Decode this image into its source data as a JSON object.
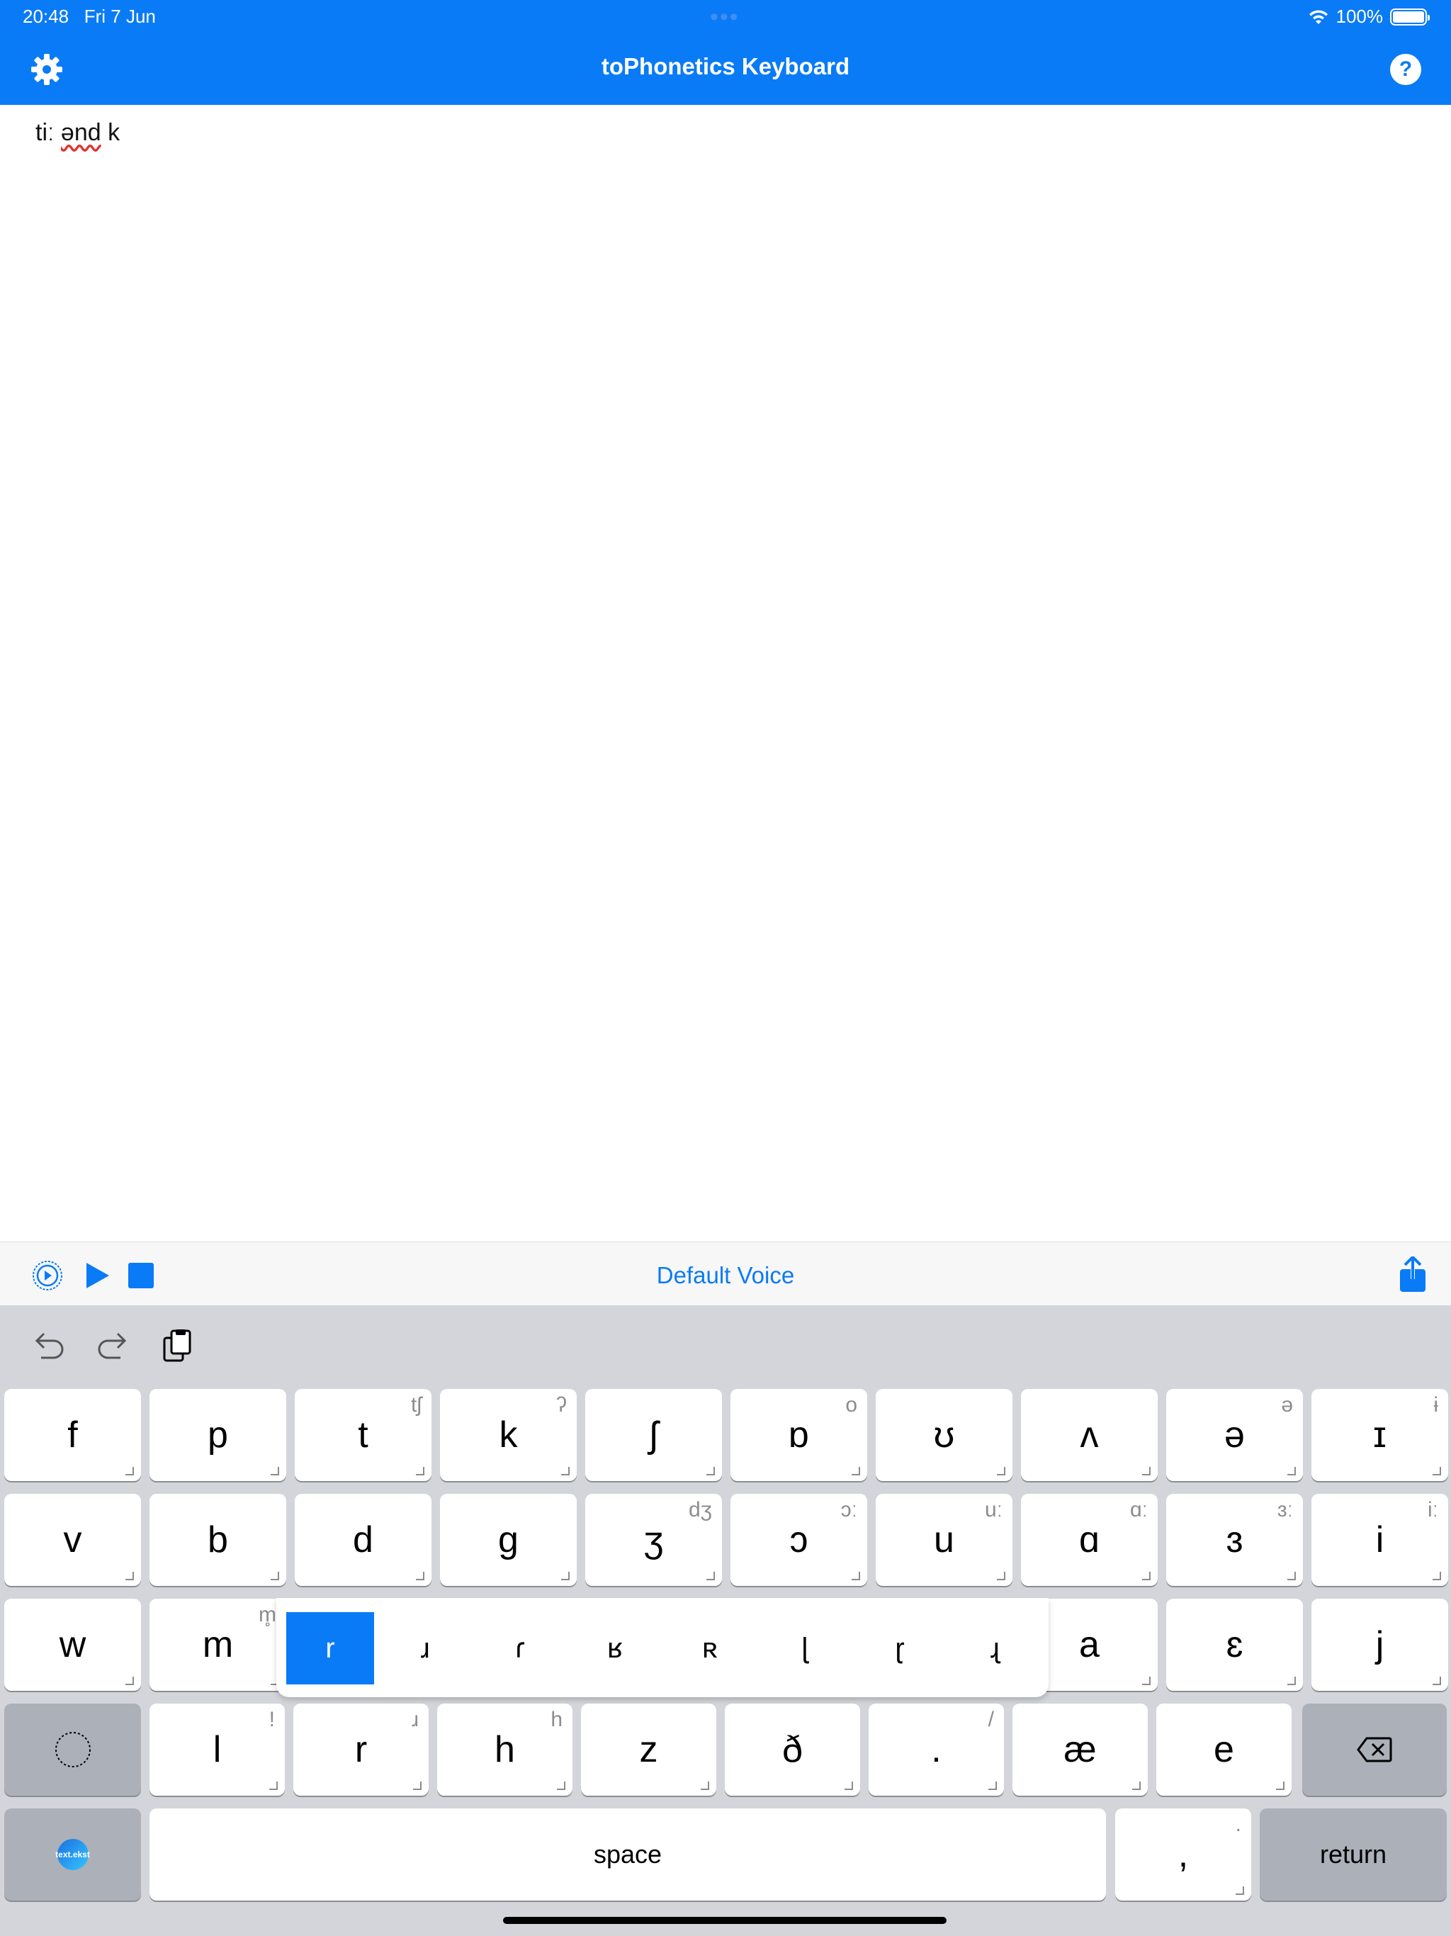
{
  "status": {
    "time": "20:48",
    "date": "Fri 7 Jun",
    "battery": "100%"
  },
  "nav": {
    "title": "toPhonetics Keyboard",
    "help": "?"
  },
  "editor": {
    "text_before": "tiː ",
    "text_squiggle": "ənd",
    "text_after": " k"
  },
  "speech_bar": {
    "voice": "Default Voice"
  },
  "keyboard": {
    "row1": [
      {
        "label": "f",
        "sec": ""
      },
      {
        "label": "p",
        "sec": ""
      },
      {
        "label": "t",
        "sec": "tʃ"
      },
      {
        "label": "k",
        "sec": "ʔ"
      },
      {
        "label": "ʃ",
        "sec": ""
      },
      {
        "label": "ɒ",
        "sec": "o"
      },
      {
        "label": "ʊ",
        "sec": ""
      },
      {
        "label": "ʌ",
        "sec": ""
      },
      {
        "label": "ə",
        "sec": "ə"
      },
      {
        "label": "ɪ",
        "sec": "ɨ"
      }
    ],
    "row2": [
      {
        "label": "v",
        "sec": ""
      },
      {
        "label": "b",
        "sec": ""
      },
      {
        "label": "d",
        "sec": ""
      },
      {
        "label": "g",
        "sec": ""
      },
      {
        "label": "ʒ",
        "sec": "dʒ"
      },
      {
        "label": "ɔ",
        "sec": "ɔː"
      },
      {
        "label": "u",
        "sec": "uː"
      },
      {
        "label": "ɑ",
        "sec": "ɑː"
      },
      {
        "label": "ɜ",
        "sec": "ɜː"
      },
      {
        "label": "i",
        "sec": "iː"
      }
    ],
    "row3": [
      {
        "label": "w",
        "sec": ""
      },
      {
        "label": "m",
        "sec": "m̥"
      },
      {
        "label": "a",
        "sec": ""
      },
      {
        "label": "ɛ",
        "sec": ""
      },
      {
        "label": "j",
        "sec": ""
      }
    ],
    "popup": [
      "r",
      "ɹ",
      "ɾ",
      "ʁ",
      "ʀ",
      "ɭ",
      "ɽ",
      "ɻ"
    ],
    "row4": [
      {
        "label": "l",
        "sec": "ǃ"
      },
      {
        "label": "r",
        "sec": "ɹ"
      },
      {
        "label": "h",
        "sec": "h"
      },
      {
        "label": "z",
        "sec": ""
      },
      {
        "label": "ð",
        "sec": ""
      },
      {
        "label": ".",
        "sec": "/"
      },
      {
        "label": "æ",
        "sec": ""
      },
      {
        "label": "e",
        "sec": ""
      }
    ],
    "space": "space",
    "comma": {
      "label": ",",
      "sec": "."
    },
    "return": "return",
    "logo": "text.ekst"
  },
  "colors": {
    "accent": "#0a7bf6",
    "keyboard_bg": "#d3d5da",
    "dark_key": "#acb0b8"
  }
}
